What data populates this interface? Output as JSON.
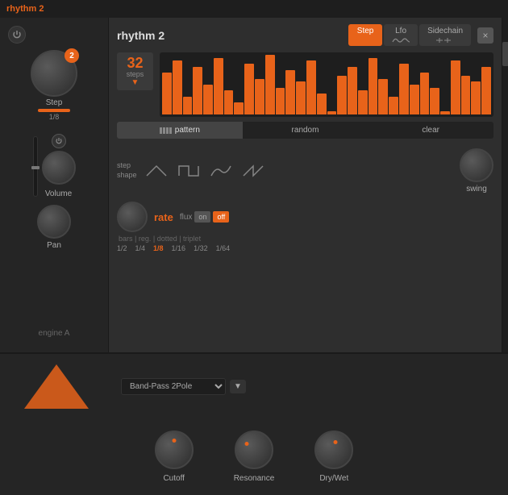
{
  "app": {
    "title": "rhythm 2"
  },
  "header": {
    "close_label": "×"
  },
  "tabs": [
    {
      "id": "step",
      "label": "Step",
      "active": true
    },
    {
      "id": "lfo",
      "label": "Lfo",
      "active": false
    },
    {
      "id": "sidechain",
      "label": "Sidechain",
      "active": false
    }
  ],
  "rhythm_panel": {
    "title": "rhythm 2"
  },
  "sequencer": {
    "steps_count": "32",
    "steps_label": "steps"
  },
  "pattern_buttons": [
    {
      "id": "pattern",
      "label": "pattern",
      "active": true
    },
    {
      "id": "random",
      "label": "random",
      "active": false
    },
    {
      "id": "clear",
      "label": "clear",
      "active": false
    }
  ],
  "step_shape": {
    "label_line1": "step",
    "label_line2": "shape"
  },
  "rate": {
    "label": "rate",
    "flux_label": "flux",
    "on_label": "on",
    "off_label": "off",
    "options_label": "bars | reg. | dotted | triplet",
    "values": [
      "1/2",
      "1/4",
      "1/8",
      "1/16",
      "1/32",
      "1/64"
    ],
    "active_value": "1/8",
    "swing_label": "swing"
  },
  "sidebar": {
    "step_label": "Step",
    "step_sub": "1/8",
    "volume_label": "Volume",
    "pan_label": "Pan",
    "engine_label": "engine A"
  },
  "bottom": {
    "cutoff_label": "Cutoff",
    "resonance_label": "Resonance",
    "drywet_label": "Dry/Wet",
    "filter_value": "Band-Pass 2Pole"
  },
  "bars": [
    {
      "height": 70
    },
    {
      "height": 90
    },
    {
      "height": 30
    },
    {
      "height": 80
    },
    {
      "height": 50
    },
    {
      "height": 95
    },
    {
      "height": 40
    },
    {
      "height": 20
    },
    {
      "height": 85
    },
    {
      "height": 60
    },
    {
      "height": 100
    },
    {
      "height": 45
    },
    {
      "height": 75
    },
    {
      "height": 55
    },
    {
      "height": 90
    },
    {
      "height": 35
    },
    {
      "height": 5
    },
    {
      "height": 65
    },
    {
      "height": 80
    },
    {
      "height": 40
    },
    {
      "height": 95
    },
    {
      "height": 60
    },
    {
      "height": 30
    },
    {
      "height": 85
    },
    {
      "height": 50
    },
    {
      "height": 70
    },
    {
      "height": 45
    },
    {
      "height": 5
    },
    {
      "height": 90
    },
    {
      "height": 65
    },
    {
      "height": 55
    },
    {
      "height": 80
    }
  ]
}
